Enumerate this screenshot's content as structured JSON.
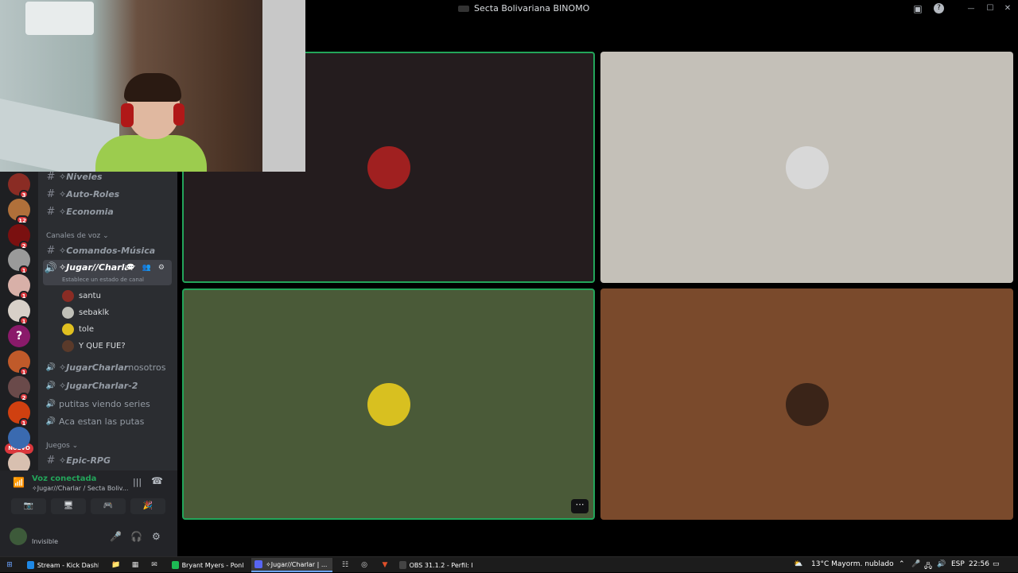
{
  "window": {
    "title": "Secta Bolivariana BINOMO",
    "server_badge": "BINOMO",
    "buttons": {
      "inbox": "▣",
      "help": "?",
      "minimize": "—",
      "maximize": "☐",
      "close": "✕"
    }
  },
  "rail": {
    "servers": [
      {
        "badge": "3",
        "color": "#8a2c24"
      },
      {
        "badge": "12",
        "color": "#b0703a"
      },
      {
        "badge": "2",
        "color": "#7a1010"
      },
      {
        "badge": "1",
        "color": "#9a9a9a"
      },
      {
        "badge": "1",
        "color": "#d8b0a8"
      },
      {
        "badge": "1",
        "color": "#d8d0c8"
      },
      {
        "badge": "1",
        "color": "#8a1a6a",
        "glyph": "?"
      },
      {
        "badge": "1",
        "color": "#c05a2a"
      },
      {
        "badge": "2",
        "color": "#6a4a4a"
      },
      {
        "badge": "1",
        "color": "#d04010"
      },
      {
        "badge": "",
        "color": "#3a6ab0"
      },
      {
        "badge": "",
        "color": "#d8c0b0"
      }
    ],
    "new_label": "NUEVO"
  },
  "sidebar": {
    "text_channels_top": [
      "✧Niveles",
      "✧Auto-Roles",
      "✧Economia"
    ],
    "voice_category": "Canales de voz",
    "music_channel": "✧Comandos-Música",
    "active_channel": {
      "name": "✧Jugar//Charlar",
      "status_hint": "Establece un estado de canal",
      "icons": "💬 👥 ⚙"
    },
    "voice_users": [
      {
        "name": "santu",
        "color": "#8a2c24"
      },
      {
        "name": "sebaklk",
        "color": "#c0c0b8"
      },
      {
        "name": "tole",
        "color": "#e0c020"
      },
      {
        "name": "Y QUE FUE?",
        "color": "#5a3a2a"
      }
    ],
    "voice_channels": [
      {
        "name": "✧JugarCharlar",
        "suffix": " nosotros",
        "italic": true
      },
      {
        "name": "✧JugarCharlar-2",
        "suffix": "",
        "italic": true
      },
      {
        "name": "putitas viendo series",
        "suffix": "",
        "italic": false
      },
      {
        "name": "Aca estan las putas",
        "suffix": "",
        "italic": false
      }
    ],
    "games_category": "Juegos",
    "games_channel": "✧Epic-RPG"
  },
  "voice_panel": {
    "status": "Voz conectada",
    "channel_path": "✧Jugar//Charlar / Secta Boliv...",
    "buttons": [
      "📷",
      "🖥",
      "🎮",
      "🎉"
    ]
  },
  "user_bar": {
    "status": "Invisible",
    "icons": {
      "mic": "🎤",
      "headphones": "🎧",
      "settings": "⚙"
    }
  },
  "tiles": [
    {
      "bg": "#241c1e",
      "speaking": true,
      "avatar": "#a02020"
    },
    {
      "bg": "#c4c0b8",
      "speaking": false,
      "avatar": "#d8d8d8"
    },
    {
      "bg": "#4a5a38",
      "speaking": true,
      "avatar": "#d8c020",
      "more": "⋯"
    },
    {
      "bg": "#7a4a2c",
      "speaking": false,
      "avatar": "#3a2418"
    }
  ],
  "taskbar": {
    "tasks": [
      {
        "label": "Stream - Kick Dashb...",
        "color": "#1e88e5"
      },
      {
        "label": "Bryant Myers - Ponle...",
        "color": "#1db954"
      },
      {
        "label": "✧Jugar//Charlar | ...",
        "color": "#5865f2",
        "active": true
      },
      {
        "label": "OBS 31.1.2 - Perfil: ki...",
        "color": "#444444"
      }
    ],
    "weather": "13°C  Mayorm. nublado",
    "lang": "ESP",
    "time": "22:56"
  }
}
